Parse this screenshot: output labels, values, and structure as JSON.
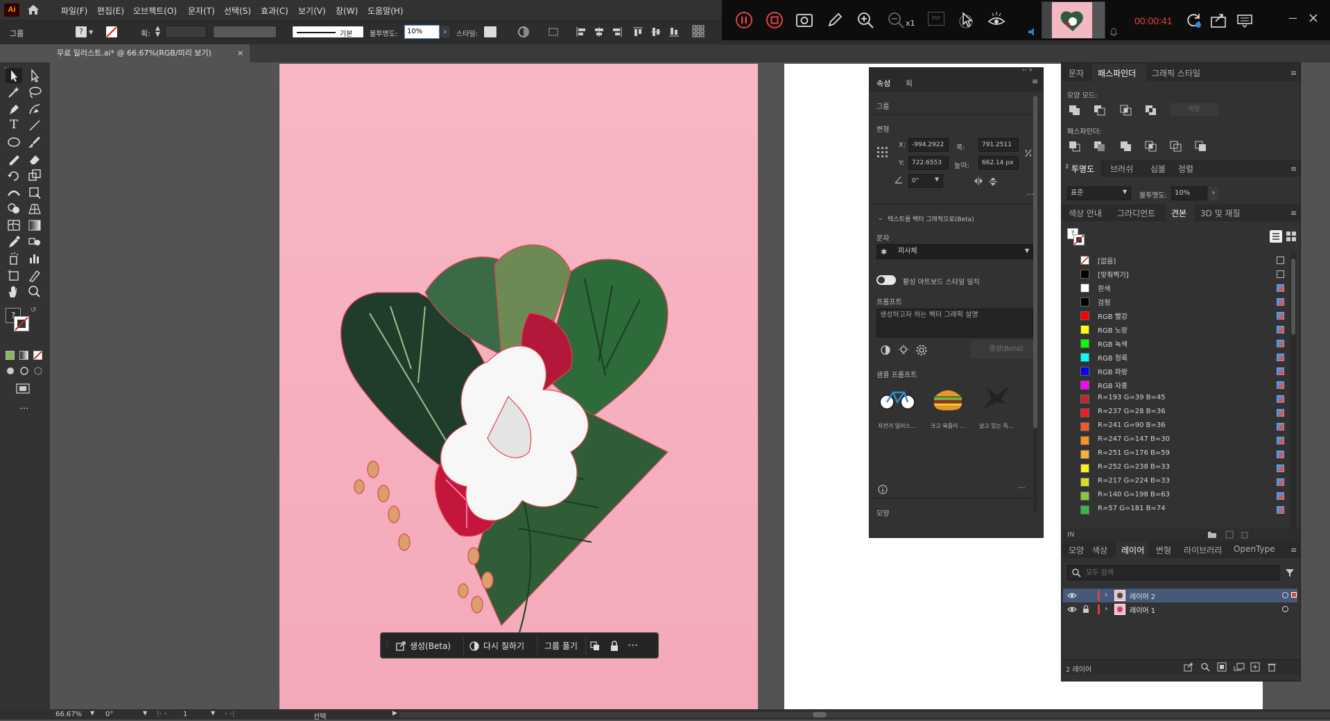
{
  "app": {
    "logo": "Ai"
  },
  "menu": [
    "파일(F)",
    "편집(E)",
    "오브젝트(O)",
    "문자(T)",
    "선택(S)",
    "효과(C)",
    "보기(V)",
    "창(W)",
    "도움말(H)"
  ],
  "control": {
    "selection_type": "그룹",
    "stroke_label": "획:",
    "stroke_style": "기본",
    "opacity_label": "불투명도:",
    "opacity_value": "10%",
    "style_label": "스타일:"
  },
  "recorder": {
    "zoom_label": "x1",
    "pip_label": "PIP",
    "timer": "00:00:41"
  },
  "document_tab": {
    "title": "무료 일러스트.ai* @ 66.67%(RGB/미리 보기)"
  },
  "context_bar": {
    "generate": "생성(Beta)",
    "recolor": "다시 칠하기",
    "ungroup": "그룹 풀기"
  },
  "properties": {
    "tabs": [
      "속성",
      "획"
    ],
    "section_group": "그룹",
    "section_transform": "변형",
    "x_label": "X:",
    "x_value": "-994.2922",
    "y_label": "Y:",
    "y_value": "722.6553",
    "w_label": "폭:",
    "w_value": "791.2511",
    "h_label": "높이:",
    "h_value": "662.14 px",
    "angle_value": "0°",
    "vector_section": "텍스트를 벡터 그래픽으로(Beta)",
    "subject_label": "문자",
    "subject_value": "피사체",
    "match_style": "활성 아트보드 스타일 일치",
    "prompt_label": "프롬프트",
    "prompt_placeholder": "생성하고자 하는 벡터 그래픽 설명",
    "generate_btn": "생성(Beta)",
    "samples_label": "샘플 프롬프트",
    "samples": [
      "자전거 일러스...",
      "크고 육즙이 ...",
      "날고 있는 독..."
    ],
    "appearance_label": "모양"
  },
  "right_panel": {
    "top_tabs": [
      "문자",
      "패스파인더",
      "그래픽 스타일"
    ],
    "shape_modes": "모양 모드:",
    "expand_btn": "확장",
    "pathfinders": "패스파인더:",
    "trans_tabs": [
      "투명도",
      "브러쉬",
      "심볼",
      "정렬"
    ],
    "blend_mode": "표준",
    "opacity_label": "불투명도:",
    "opacity_value": "10%",
    "swatch_tabs": [
      "색상 안내",
      "그라디언트",
      "견본",
      "3D 및 재질"
    ],
    "swatches": [
      {
        "name": "[없음]",
        "color": "none"
      },
      {
        "name": "[맞춰찍기]",
        "color": "#000000"
      },
      {
        "name": "흰색",
        "color": "#ffffff"
      },
      {
        "name": "검정",
        "color": "#000000"
      },
      {
        "name": "RGB 빨강",
        "color": "#ff0000"
      },
      {
        "name": "RGB 노랑",
        "color": "#ffff00"
      },
      {
        "name": "RGB 녹색",
        "color": "#00ff00"
      },
      {
        "name": "RGB 청록",
        "color": "#00ffff"
      },
      {
        "name": "RGB 파랑",
        "color": "#0000ff"
      },
      {
        "name": "RGB 자홍",
        "color": "#ff00ff"
      },
      {
        "name": "R=193 G=39 B=45",
        "color": "#c1272d"
      },
      {
        "name": "R=237 G=28 B=36",
        "color": "#ed1c24"
      },
      {
        "name": "R=241 G=90 B=36",
        "color": "#f15a24"
      },
      {
        "name": "R=247 G=147 B=30",
        "color": "#f7931e"
      },
      {
        "name": "R=251 G=176 B=59",
        "color": "#fbb03b"
      },
      {
        "name": "R=252 G=238 B=33",
        "color": "#fcee21"
      },
      {
        "name": "R=217 G=224 B=33",
        "color": "#d9e021"
      },
      {
        "name": "R=140 G=198 B=63",
        "color": "#8cc63f"
      },
      {
        "name": "R=57 G=181 B=74",
        "color": "#39b54a"
      }
    ],
    "layer_tabs": [
      "모양",
      "색상",
      "레이어",
      "변형",
      "라이브러리",
      "OpenType"
    ],
    "layer_search_placeholder": "모두 검색",
    "layers": [
      "레이어 2",
      "레이어 1"
    ],
    "layer_count": "2 레이어"
  },
  "status": {
    "zoom": "66.67%",
    "rotation": "0°",
    "artboard": "1",
    "tool": "선택"
  }
}
